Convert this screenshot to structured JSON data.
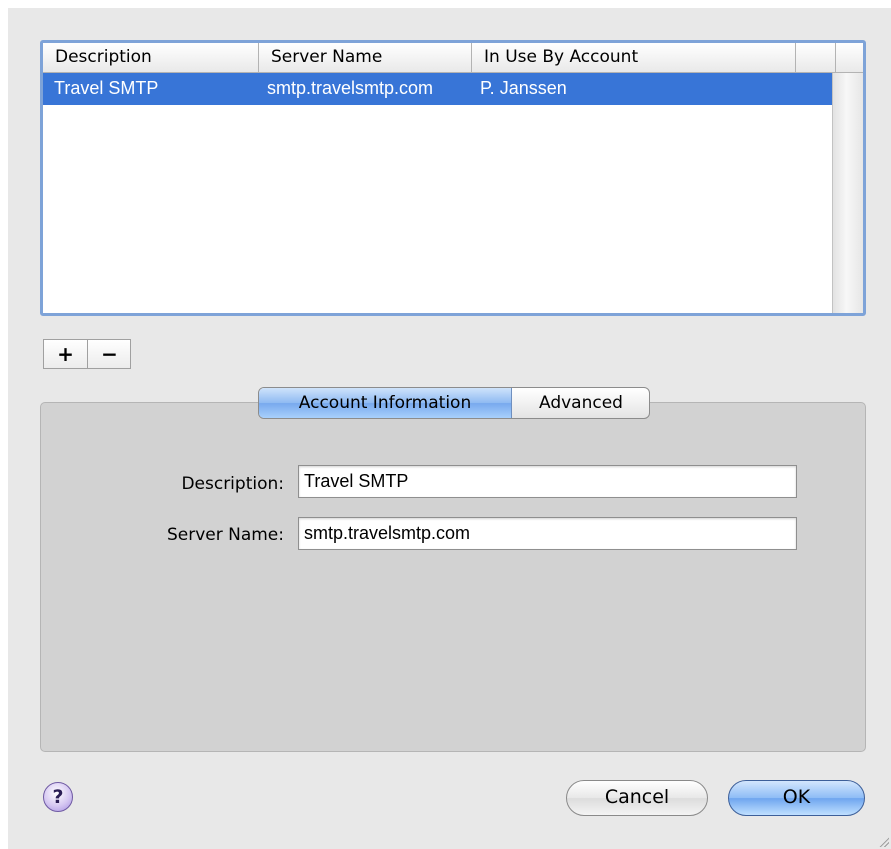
{
  "server_table": {
    "columns": [
      "Description",
      "Server Name",
      "In Use By Account"
    ],
    "rows": [
      {
        "description": "Travel SMTP",
        "server_name": "smtp.travelsmtp.com",
        "in_use_by": "P. Janssen",
        "selected": true
      }
    ],
    "selection_color": "#3875d7"
  },
  "list_buttons": {
    "add": "+",
    "remove": "−"
  },
  "tabs": [
    {
      "label": "Account Information",
      "active": true
    },
    {
      "label": "Advanced",
      "active": false
    }
  ],
  "form": {
    "description": {
      "label": "Description:",
      "value": "Travel SMTP"
    },
    "server_name": {
      "label": "Server Name:",
      "value": "smtp.travelsmtp.com"
    }
  },
  "footer": {
    "help": "?",
    "cancel": "Cancel",
    "ok": "OK"
  },
  "icons": [
    "help-icon",
    "resize-grip-icon"
  ]
}
